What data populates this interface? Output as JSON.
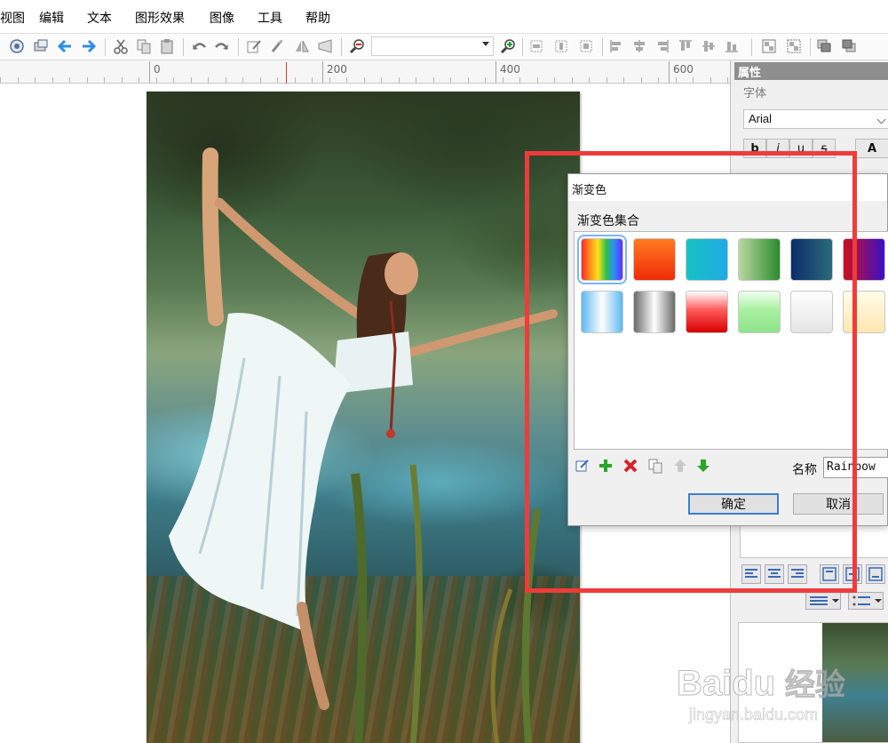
{
  "menu": [
    "视图",
    "编辑",
    "文本",
    "图形效果",
    "图像",
    "工具",
    "帮助"
  ],
  "ruler": {
    "labels": [
      "0",
      "200",
      "400",
      "600"
    ]
  },
  "properties": {
    "title": "属性",
    "section": "字体",
    "font_name": "Arial",
    "format_buttons": [
      "b",
      "i",
      "u",
      "s"
    ],
    "color_button": "A"
  },
  "dialog": {
    "title": "渐变色",
    "section_title": "渐变色集合",
    "name_label": "名称",
    "name_value": "Rainbow",
    "ok_label": "确定",
    "cancel_label": "取消",
    "gradients": [
      {
        "name": "rainbow",
        "css": "linear-gradient(90deg,#ff2a2a,#ff8c1a,#ffe11a,#2ec24a,#2a8cff,#6a2aff)"
      },
      {
        "name": "fire",
        "css": "linear-gradient(180deg,#ff7b1f,#f02a0a)"
      },
      {
        "name": "aqua",
        "css": "linear-gradient(90deg,#17c3c2,#1fa9e6)"
      },
      {
        "name": "green",
        "css": "linear-gradient(90deg,#b9d8a0,#2a8b2e)"
      },
      {
        "name": "navy-teal",
        "css": "linear-gradient(90deg,#0d2d6b,#2b6a7a)"
      },
      {
        "name": "purple-red",
        "css": "linear-gradient(90deg,#cc1020,#3a10c8)"
      },
      {
        "name": "sky-blue",
        "css": "linear-gradient(90deg,#5eb8f0,#ffffff,#5eb8f0)"
      },
      {
        "name": "silver",
        "css": "linear-gradient(90deg,#6a6a6a,#ffffff,#6a6a6a)"
      },
      {
        "name": "red",
        "css": "linear-gradient(180deg,#ffffff 0%,#ff5a5a 45%,#d80000 100%)"
      },
      {
        "name": "light-green",
        "css": "linear-gradient(180deg,#f0fff0 0%,#a8f0a0 45%,#8ee48a 100%)"
      },
      {
        "name": "white",
        "css": "linear-gradient(180deg,#ffffff,#e4e4e4)"
      },
      {
        "name": "cream",
        "css": "linear-gradient(180deg,#fffde8,#ffe6b0)"
      }
    ]
  },
  "watermark": {
    "brand": "Baidu",
    "brand_cn": "经验",
    "url": "jingyan.baidu.com"
  }
}
